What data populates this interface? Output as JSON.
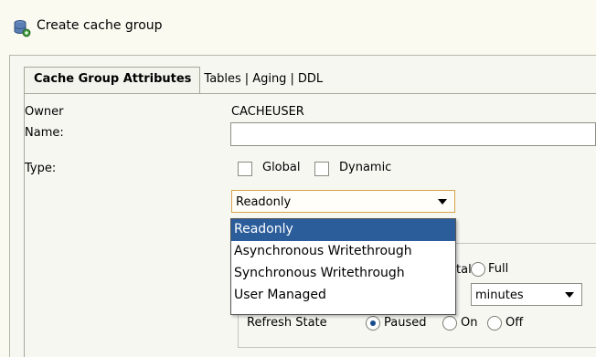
{
  "window": {
    "title": "Create cache group",
    "icon": "database-icon"
  },
  "tabs": [
    {
      "label": "Cache Group Attributes",
      "active": true
    },
    {
      "label": "Tables"
    },
    {
      "label": "Aging"
    },
    {
      "label": "DDL"
    }
  ],
  "tab_separator": "|",
  "form": {
    "owner_label": "Owner",
    "owner_value": "CACHEUSER",
    "name_label": "Name:",
    "name_value": "",
    "type_label": "Type:",
    "global_label": "Global",
    "dynamic_label": "Dynamic",
    "type_selected": "Readonly"
  },
  "type_options": [
    "Readonly",
    "Asynchronous Writethrough",
    "Synchronous Writethrough",
    "User Managed"
  ],
  "refresh": {
    "incremental_partial": "tal",
    "full_label": "Full",
    "units_value": "minutes",
    "state_label": "Refresh State",
    "paused_label": "Paused",
    "on_label": "On",
    "off_label": "Off",
    "state_selected": "Paused"
  },
  "colors": {
    "background": "#fbfaf0",
    "selected_item": "#2b5d9b",
    "select_border": "#d6a34a"
  }
}
